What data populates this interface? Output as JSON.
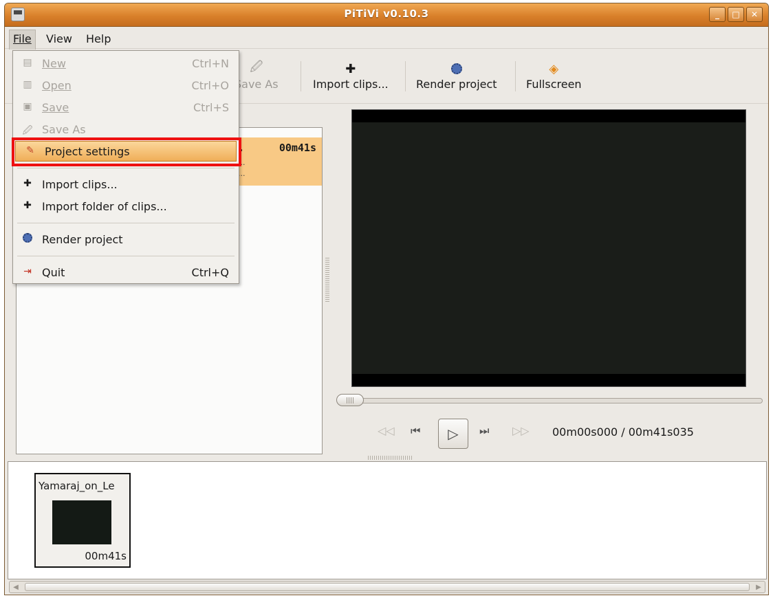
{
  "window": {
    "title": "PiTiVi v0.10.3",
    "min": "_",
    "max": "□",
    "close": "✕"
  },
  "menubar": {
    "file": "File",
    "view": "View",
    "help": "Help"
  },
  "toolbar": {
    "save_as": "Save As",
    "import_clips": "Import clips...",
    "render_project": "Render project",
    "fullscreen": "Fullscreen"
  },
  "file_menu": {
    "items": [
      {
        "label": "New",
        "accel": "Ctrl+N",
        "icon": "new-icon",
        "enabled": false
      },
      {
        "label": "Open",
        "accel": "Ctrl+O",
        "icon": "open-icon",
        "enabled": false
      },
      {
        "label": "Save",
        "accel": "Ctrl+S",
        "icon": "save-icon",
        "enabled": false
      },
      {
        "label": "Save As",
        "accel": "",
        "icon": "save-as-icon",
        "enabled": false
      },
      {
        "label": "Project settings",
        "accel": "",
        "icon": "project-settings-icon",
        "enabled": true,
        "highlighted": true
      },
      {
        "label": "Import clips...",
        "accel": "",
        "icon": "plus-icon",
        "enabled": true
      },
      {
        "label": "Import folder of clips...",
        "accel": "",
        "icon": "plus-icon",
        "enabled": true
      },
      {
        "label": "Render project",
        "accel": "",
        "icon": "render-icon",
        "enabled": true
      },
      {
        "label": "Quit",
        "accel": "Ctrl+Q",
        "icon": "quit-icon",
        "enabled": true
      }
    ]
  },
  "clip_library": {
    "selected_clip": {
      "truncated_name": "..",
      "duration": "00m41s",
      "line2": "...",
      "line3": "..."
    }
  },
  "viewer": {
    "timecode": "00m00s000 / 00m41s035",
    "position_fraction": 0.0
  },
  "timeline": {
    "clip": {
      "name": "Yamaraj_on_Le",
      "duration": "00m41s"
    }
  }
}
